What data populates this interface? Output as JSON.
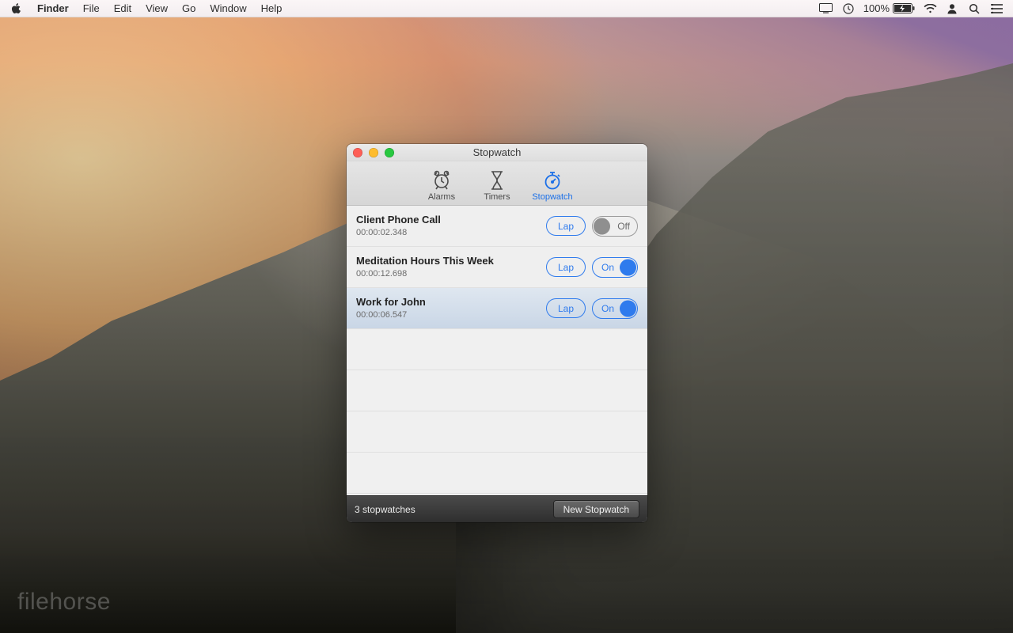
{
  "menubar": {
    "app_name": "Finder",
    "menus": [
      "File",
      "Edit",
      "View",
      "Go",
      "Window",
      "Help"
    ],
    "battery_percent": "100%"
  },
  "window": {
    "title": "Stopwatch",
    "tabs": {
      "alarms": "Alarms",
      "timers": "Timers",
      "stopwatch": "Stopwatch",
      "active": "stopwatch"
    },
    "stopwatches": [
      {
        "name": "Client Phone Call",
        "time": "00:00:02.348",
        "running": false,
        "selected": false
      },
      {
        "name": "Meditation Hours This Week",
        "time": "00:00:12.698",
        "running": true,
        "selected": false
      },
      {
        "name": "Work for John",
        "time": "00:00:06.547",
        "running": true,
        "selected": true
      }
    ],
    "lap_label": "Lap",
    "on_label": "On",
    "off_label": "Off",
    "footer_count": "3 stopwatches",
    "new_button": "New Stopwatch"
  },
  "watermark": "filehorse"
}
